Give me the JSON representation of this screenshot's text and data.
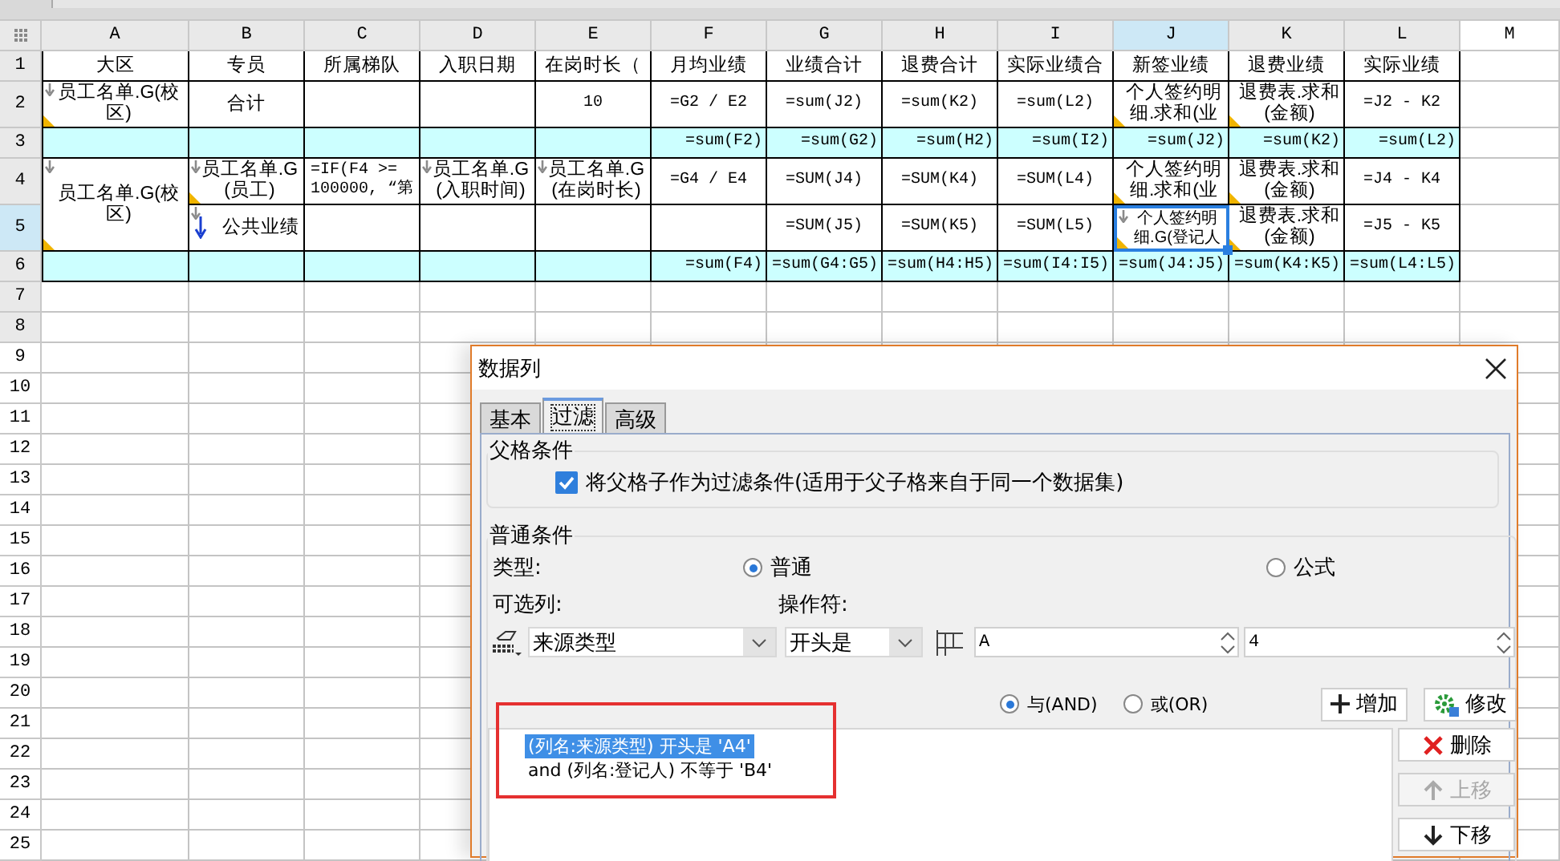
{
  "sheet": {
    "columns": [
      {
        "label": "A",
        "selected": false,
        "shaded": true
      },
      {
        "label": "B",
        "selected": false,
        "shaded": true
      },
      {
        "label": "C",
        "selected": false,
        "shaded": true
      },
      {
        "label": "D",
        "selected": false,
        "shaded": true
      },
      {
        "label": "E",
        "selected": false,
        "shaded": true
      },
      {
        "label": "F",
        "selected": false,
        "shaded": true
      },
      {
        "label": "G",
        "selected": false,
        "shaded": true
      },
      {
        "label": "H",
        "selected": false,
        "shaded": true
      },
      {
        "label": "I",
        "selected": false,
        "shaded": true
      },
      {
        "label": "J",
        "selected": true,
        "shaded": true
      },
      {
        "label": "K",
        "selected": false,
        "shaded": true
      },
      {
        "label": "L",
        "selected": false,
        "shaded": true
      },
      {
        "label": "M",
        "selected": false,
        "shaded": false
      }
    ],
    "rows": [
      {
        "label": "1",
        "selected": false,
        "shaded": true,
        "band": false,
        "cells": [
          {
            "text": "大区",
            "kind": "text",
            "selected": false,
            "expand": false,
            "corner": false
          },
          {
            "text": "专员",
            "kind": "text",
            "selected": false,
            "expand": false,
            "corner": false
          },
          {
            "text": "所属梯队",
            "kind": "text",
            "selected": false,
            "expand": false,
            "corner": false
          },
          {
            "text": "入职日期",
            "kind": "text",
            "selected": false,
            "expand": false,
            "corner": false
          },
          {
            "text": "在岗时长（",
            "kind": "text",
            "selected": false,
            "expand": false,
            "corner": false
          },
          {
            "text": "月均业绩",
            "kind": "text",
            "selected": false,
            "expand": false,
            "corner": false
          },
          {
            "text": "业绩合计",
            "kind": "text",
            "selected": false,
            "expand": false,
            "corner": false
          },
          {
            "text": "退费合计",
            "kind": "text",
            "selected": false,
            "expand": false,
            "corner": false
          },
          {
            "text": "实际业绩合",
            "kind": "text",
            "selected": false,
            "expand": false,
            "corner": false
          },
          {
            "text": "新签业绩",
            "kind": "text",
            "selected": false,
            "expand": false,
            "corner": false
          },
          {
            "text": "退费业绩",
            "kind": "text",
            "selected": false,
            "expand": false,
            "corner": false
          },
          {
            "text": "实际业绩",
            "kind": "text",
            "selected": false,
            "expand": false,
            "corner": false
          }
        ]
      },
      {
        "label": "2",
        "selected": false,
        "shaded": true,
        "band": false,
        "cells": [
          {
            "text": "员工名单.G(校区)",
            "kind": "text",
            "selected": false,
            "expand": true,
            "corner": true
          },
          {
            "text": "合计",
            "kind": "text",
            "selected": false,
            "expand": false,
            "corner": false
          },
          {
            "kind": "text",
            "selected": false,
            "expand": false,
            "corner": false
          },
          {
            "kind": "text",
            "selected": false,
            "expand": false,
            "corner": false
          },
          {
            "text": "10",
            "kind": "formula",
            "selected": false,
            "expand": false,
            "corner": false
          },
          {
            "text": "=G2 / E2",
            "kind": "formula",
            "selected": false,
            "expand": false,
            "corner": false
          },
          {
            "text": "=sum(J2)",
            "kind": "formula",
            "selected": false,
            "expand": false,
            "corner": false
          },
          {
            "text": "=sum(K2)",
            "kind": "formula",
            "selected": false,
            "expand": false,
            "corner": false
          },
          {
            "text": "=sum(L2)",
            "kind": "formula",
            "selected": false,
            "expand": false,
            "corner": false
          },
          {
            "text": "个人签约明细.求和(业",
            "kind": "text",
            "selected": false,
            "expand": false,
            "corner": true
          },
          {
            "text": "退费表.求和(金额)",
            "kind": "text",
            "selected": false,
            "expand": false,
            "corner": true
          },
          {
            "text": "=J2 - K2",
            "kind": "formula",
            "selected": false,
            "expand": false,
            "corner": false
          }
        ]
      },
      {
        "label": "3",
        "selected": false,
        "shaded": true,
        "band": true,
        "cells": [
          {
            "kind": "text",
            "selected": false,
            "expand": false,
            "corner": false
          },
          {
            "kind": "text",
            "selected": false,
            "expand": false,
            "corner": false
          },
          {
            "kind": "text",
            "selected": false,
            "expand": false,
            "corner": false
          },
          {
            "kind": "text",
            "selected": false,
            "expand": false,
            "corner": false
          },
          {
            "kind": "text",
            "selected": false,
            "expand": false,
            "corner": false
          },
          {
            "text": "=sum(F2)",
            "kind": "formula",
            "selected": false,
            "expand": false,
            "corner": false
          },
          {
            "text": "=sum(G2)",
            "kind": "formula",
            "selected": false,
            "expand": false,
            "corner": false
          },
          {
            "text": "=sum(H2)",
            "kind": "formula",
            "selected": false,
            "expand": false,
            "corner": false
          },
          {
            "text": "=sum(I2)",
            "kind": "formula",
            "selected": false,
            "expand": false,
            "corner": false
          },
          {
            "text": "=sum(J2)",
            "kind": "formula",
            "selected": false,
            "expand": false,
            "corner": false
          },
          {
            "text": "=sum(K2)",
            "kind": "formula",
            "selected": false,
            "expand": false,
            "corner": false
          },
          {
            "text": "=sum(L2)",
            "kind": "formula",
            "selected": false,
            "expand": false,
            "corner": false
          }
        ]
      },
      {
        "label": "4",
        "selected": false,
        "shaded": true,
        "band": false,
        "cells": [
          {
            "text": "员工名单.G(校区)",
            "kind": "text",
            "selected": false,
            "expand": true,
            "corner": true,
            "merge_down": true
          },
          {
            "text": "员工名单.G(员工)",
            "kind": "text",
            "selected": false,
            "expand": true,
            "corner": true
          },
          {
            "text": "=IF(F4 >= 100000, “第",
            "kind": "formula",
            "selected": false,
            "expand": false,
            "corner": false
          },
          {
            "text": "员工名单.G(入职时间)",
            "kind": "text",
            "selected": false,
            "expand": true,
            "corner": false
          },
          {
            "text": "员工名单.G(在岗时长)",
            "kind": "text",
            "selected": false,
            "expand": true,
            "corner": false
          },
          {
            "text": "=G4 / E4",
            "kind": "formula",
            "selected": false,
            "expand": false,
            "corner": false
          },
          {
            "text": "=SUM(J4)",
            "kind": "formula",
            "selected": false,
            "expand": false,
            "corner": false
          },
          {
            "text": "=SUM(K4)",
            "kind": "formula",
            "selected": false,
            "expand": false,
            "corner": false
          },
          {
            "text": "=SUM(L4)",
            "kind": "formula",
            "selected": false,
            "expand": false,
            "corner": false
          },
          {
            "text": "个人签约明细.求和(业",
            "kind": "text",
            "selected": false,
            "expand": false,
            "corner": true
          },
          {
            "text": "退费表.求和(金额)",
            "kind": "text",
            "selected": false,
            "expand": false,
            "corner": true
          },
          {
            "text": "=J4 - K4",
            "kind": "formula",
            "selected": false,
            "expand": false,
            "corner": false
          }
        ]
      },
      {
        "label": "5",
        "selected": true,
        "shaded": true,
        "band": false,
        "cells": [
          {
            "text": "公共业绩",
            "kind": "text",
            "selected": false,
            "expand": true,
            "corner": false,
            "down_arrow": true
          },
          {
            "kind": "text",
            "selected": false,
            "expand": false,
            "corner": false
          },
          {
            "kind": "text",
            "selected": false,
            "expand": false,
            "corner": false
          },
          {
            "kind": "text",
            "selected": false,
            "expand": false,
            "corner": false
          },
          {
            "kind": "text",
            "selected": false,
            "expand": false,
            "corner": false
          },
          {
            "text": "=SUM(J5)",
            "kind": "formula",
            "selected": false,
            "expand": false,
            "corner": false
          },
          {
            "text": "=SUM(K5)",
            "kind": "formula",
            "selected": false,
            "expand": false,
            "corner": false
          },
          {
            "text": "=SUM(L5)",
            "kind": "formula",
            "selected": false,
            "expand": false,
            "corner": false
          },
          {
            "text": "个人签约明细.G(登记人",
            "kind": "text",
            "selected": true,
            "expand": true,
            "corner": true
          },
          {
            "text": "退费表.求和(金额)",
            "kind": "text",
            "selected": false,
            "expand": false,
            "corner": true
          },
          {
            "text": "=J5 - K5",
            "kind": "formula",
            "selected": false,
            "expand": false,
            "corner": false
          }
        ]
      },
      {
        "label": "6",
        "selected": false,
        "shaded": true,
        "band": true,
        "cells": [
          {
            "kind": "text",
            "selected": false,
            "expand": false,
            "corner": false
          },
          {
            "kind": "text",
            "selected": false,
            "expand": false,
            "corner": false
          },
          {
            "kind": "text",
            "selected": false,
            "expand": false,
            "corner": false
          },
          {
            "kind": "text",
            "selected": false,
            "expand": false,
            "corner": false
          },
          {
            "kind": "text",
            "selected": false,
            "expand": false,
            "corner": false
          },
          {
            "text": "=sum(F4)",
            "kind": "formula",
            "selected": false,
            "expand": false,
            "corner": false
          },
          {
            "text": "=sum(G4:G5)",
            "kind": "formula",
            "selected": false,
            "expand": false,
            "corner": false
          },
          {
            "text": "=sum(H4:H5)",
            "kind": "formula",
            "selected": false,
            "expand": false,
            "corner": false
          },
          {
            "text": "=sum(I4:I5)",
            "kind": "formula",
            "selected": false,
            "expand": false,
            "corner": false
          },
          {
            "text": "=sum(J4:J5)",
            "kind": "formula",
            "selected": false,
            "expand": false,
            "corner": false
          },
          {
            "text": "=sum(K4:K5)",
            "kind": "formula",
            "selected": false,
            "expand": false,
            "corner": false
          },
          {
            "text": "=sum(L4:L5)",
            "kind": "formula",
            "selected": false,
            "expand": false,
            "corner": false
          }
        ]
      },
      {
        "label": "7",
        "selected": false,
        "shaded": true,
        "band": false
      },
      {
        "label": "8",
        "selected": false,
        "shaded": true,
        "band": false
      },
      {
        "label": "9",
        "selected": false,
        "shaded": false,
        "band": false
      },
      {
        "label": "10",
        "selected": false,
        "shaded": false,
        "band": false
      },
      {
        "label": "11",
        "selected": false,
        "shaded": false,
        "band": false
      },
      {
        "label": "12",
        "selected": false,
        "shaded": false,
        "band": false
      },
      {
        "label": "13",
        "selected": false,
        "shaded": false,
        "band": false
      },
      {
        "label": "14",
        "selected": false,
        "shaded": false,
        "band": false
      },
      {
        "label": "15",
        "selected": false,
        "shaded": false,
        "band": false
      },
      {
        "label": "16",
        "selected": false,
        "shaded": false,
        "band": false
      },
      {
        "label": "17",
        "selected": false,
        "shaded": false,
        "band": false
      },
      {
        "label": "18",
        "selected": false,
        "shaded": false,
        "band": false
      },
      {
        "label": "19",
        "selected": false,
        "shaded": false,
        "band": false
      },
      {
        "label": "20",
        "selected": false,
        "shaded": false,
        "band": false
      },
      {
        "label": "21",
        "selected": false,
        "shaded": false,
        "band": false
      },
      {
        "label": "22",
        "selected": false,
        "shaded": false,
        "band": false
      },
      {
        "label": "23",
        "selected": false,
        "shaded": false,
        "band": false
      },
      {
        "label": "24",
        "selected": false,
        "shaded": false,
        "band": false
      },
      {
        "label": "25",
        "selected": false,
        "shaded": false,
        "band": false
      }
    ]
  },
  "dialog": {
    "title": "数据列",
    "tabs": [
      {
        "label": "基本",
        "selected": false
      },
      {
        "label": "过滤",
        "selected": true
      },
      {
        "label": "高级",
        "selected": false
      }
    ],
    "parent_group": {
      "title": "父格条件",
      "checkbox": {
        "label": "将父格子作为过滤条件(适用于父子格来自于同一个数据集)",
        "checked": true
      }
    },
    "normal_group": {
      "title": "普通条件",
      "type_label": "类型:",
      "type_options": [
        {
          "label": "普通",
          "selected": true
        },
        {
          "label": "公式",
          "selected": false
        }
      ],
      "column_label": "可选列:",
      "operator_label": "操作符:",
      "column_select": {
        "value": "来源类型"
      },
      "operator_select": {
        "value": "开头是"
      },
      "value_fields": [
        {
          "value": "A"
        },
        {
          "value": "4"
        }
      ],
      "logic_options": [
        {
          "label": "与(AND)",
          "selected": true
        },
        {
          "label": "或(OR)",
          "selected": false
        }
      ],
      "add_button": "增加",
      "edit_button": "修改",
      "conditions": [
        {
          "text": "(列名:来源类型) 开头是 'A4'",
          "selected": true
        },
        {
          "text": "and (列名:登记人) 不等于 'B4'",
          "selected": false
        }
      ],
      "side_buttons": [
        {
          "label": "删除",
          "kind": "delete",
          "disabled": false
        },
        {
          "label": "上移",
          "kind": "up",
          "disabled": true
        },
        {
          "label": "下移",
          "kind": "down",
          "disabled": false
        }
      ]
    }
  }
}
